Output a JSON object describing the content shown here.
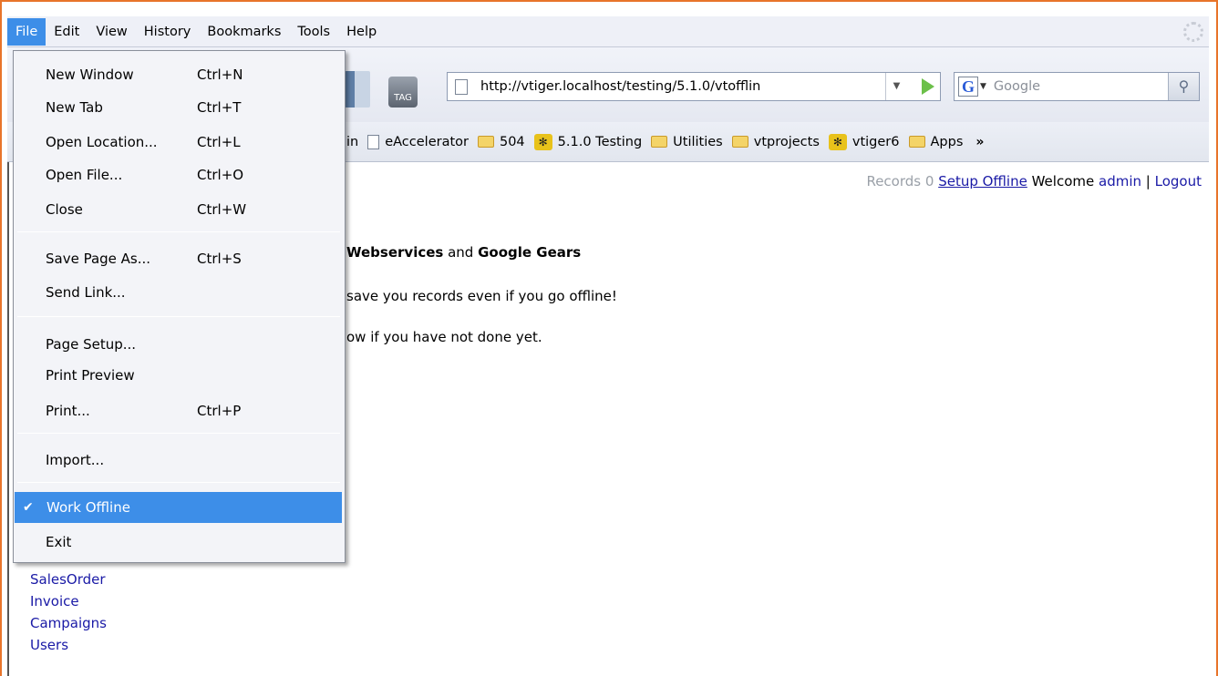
{
  "menubar": {
    "items": [
      "File",
      "Edit",
      "View",
      "History",
      "Bookmarks",
      "Tools",
      "Help"
    ],
    "active": "File"
  },
  "toolbar": {
    "tag_label": "TAG",
    "url": "http://vtiger.localhost/testing/5.1.0/vtofflin",
    "search_placeholder": "Google",
    "search_engine": "G"
  },
  "bookmarks": {
    "items": [
      {
        "label": "in",
        "icon": "none"
      },
      {
        "label": "eAccelerator",
        "icon": "page-icon"
      },
      {
        "label": "504",
        "icon": "folder-icon"
      },
      {
        "label": "5.1.0 Testing",
        "icon": "paw-icon"
      },
      {
        "label": "Utilities",
        "icon": "folder-icon"
      },
      {
        "label": "vtprojects",
        "icon": "folder-icon"
      },
      {
        "label": "vtiger6",
        "icon": "paw-icon"
      },
      {
        "label": "Apps",
        "icon": "folder-icon"
      }
    ],
    "more": "»"
  },
  "header": {
    "records": "Records 0",
    "setup_offline": "Setup Offline",
    "welcome": "Welcome",
    "user": "admin",
    "separator": "|",
    "logout": "Logout"
  },
  "content": {
    "line1_bold1": "Webservices",
    "line1_mid": " and ",
    "line1_bold2": "Google Gears",
    "line2": "save you records even if you go offline!",
    "line3": "ow if you have not done yet."
  },
  "modules": [
    "SalesOrder",
    "Invoice",
    "Campaigns",
    "Users"
  ],
  "file_menu": {
    "items": [
      {
        "label": "New Window",
        "shortcut": "Ctrl+N"
      },
      {
        "label": "New Tab",
        "shortcut": "Ctrl+T"
      },
      {
        "label": "Open Location...",
        "shortcut": "Ctrl+L"
      },
      {
        "label": "Open File...",
        "shortcut": "Ctrl+O"
      },
      {
        "label": "Close",
        "shortcut": "Ctrl+W"
      },
      {
        "label": "Save Page As...",
        "shortcut": "Ctrl+S"
      },
      {
        "label": "Send Link...",
        "shortcut": ""
      },
      {
        "label": "Page Setup...",
        "shortcut": ""
      },
      {
        "label": "Print Preview",
        "shortcut": ""
      },
      {
        "label": "Print...",
        "shortcut": "Ctrl+P"
      },
      {
        "label": "Import...",
        "shortcut": ""
      },
      {
        "label": "Work Offline",
        "shortcut": "",
        "checked": true
      },
      {
        "label": "Exit",
        "shortcut": ""
      }
    ],
    "check_mark": "✔"
  },
  "colors": {
    "highlight": "#3d8ee8",
    "frame": "#e8742a",
    "link": "#1a1aa6"
  }
}
